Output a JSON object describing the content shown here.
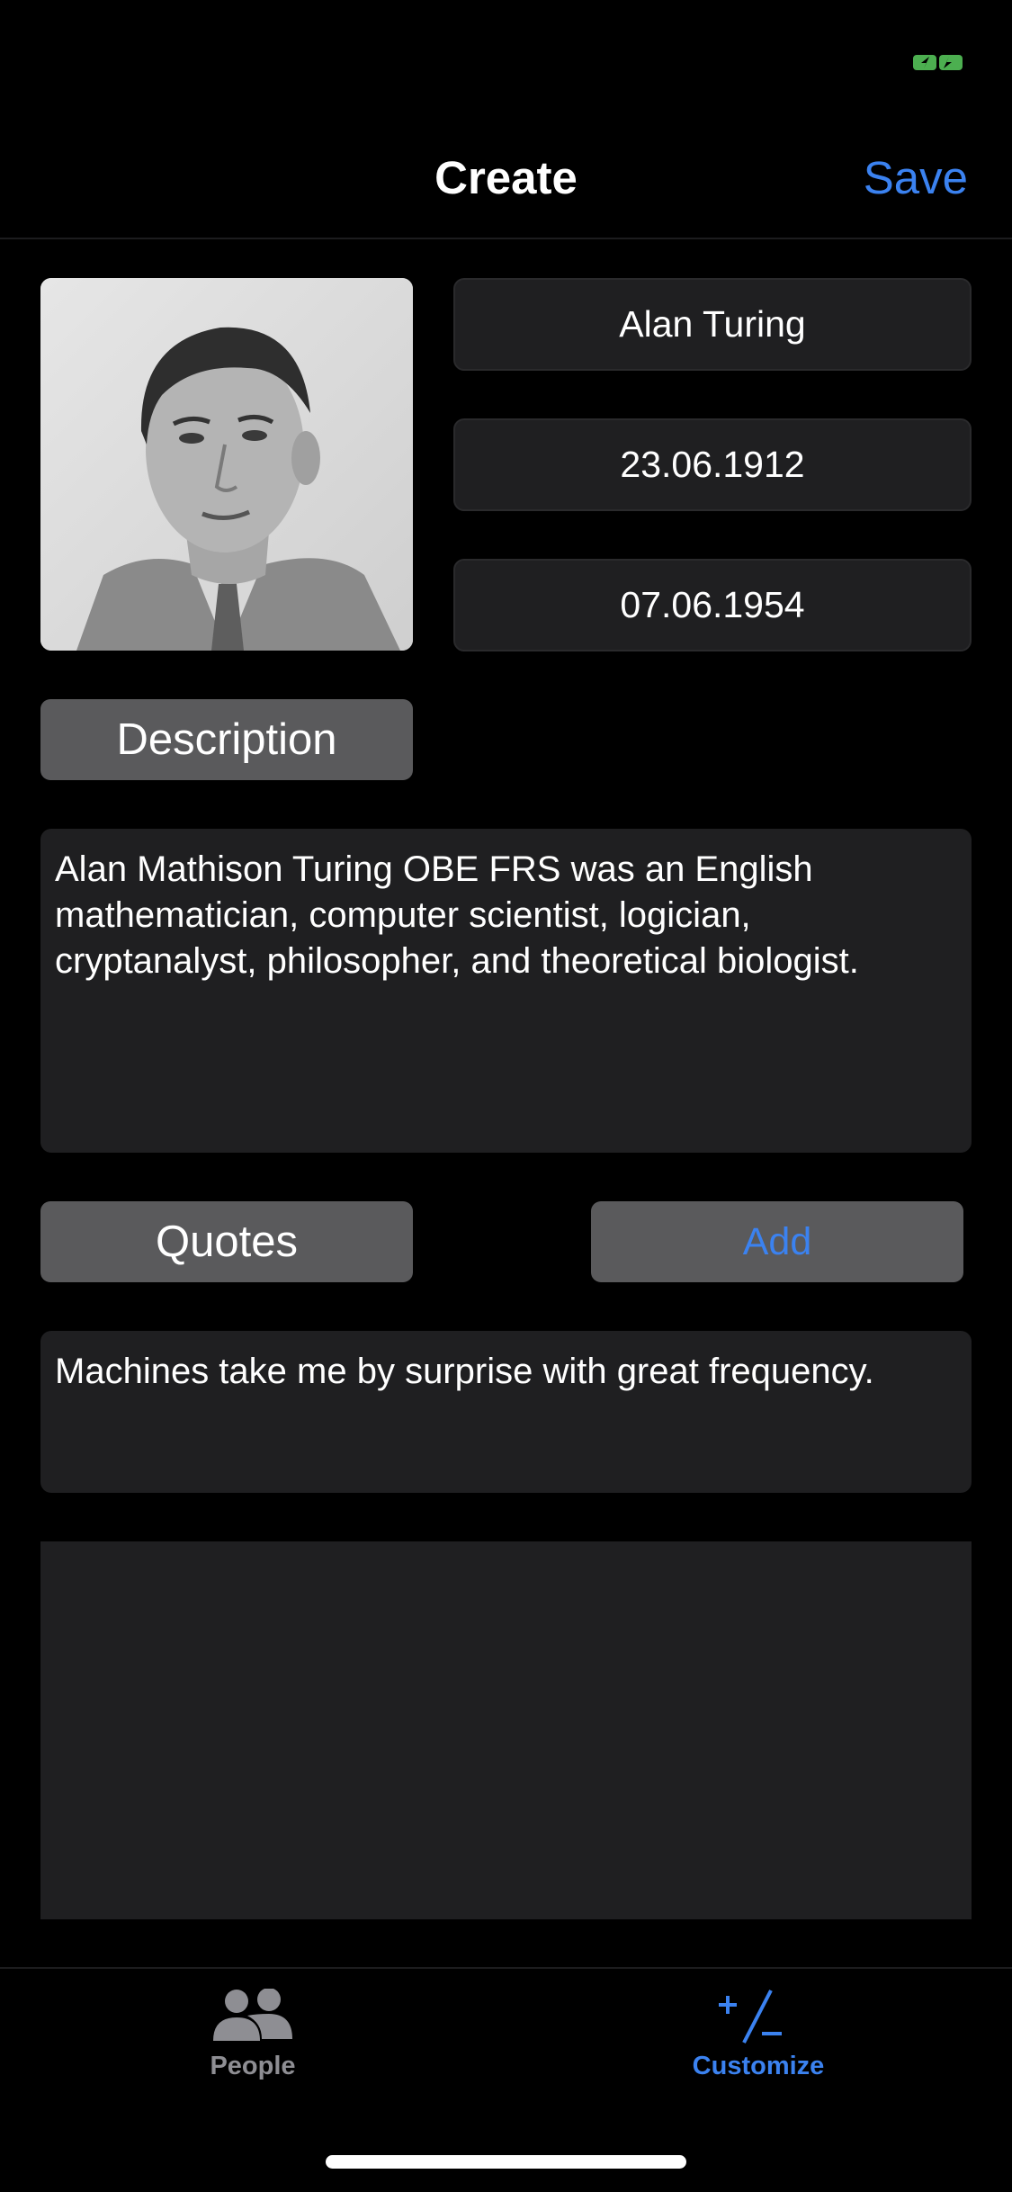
{
  "header": {
    "title": "Create",
    "save_label": "Save"
  },
  "person": {
    "name": "Alan Turing",
    "birth_date": "23.06.1912",
    "death_date": "07.06.1954"
  },
  "sections": {
    "description_label": "Description",
    "description_text": "Alan Mathison Turing OBE FRS was an English mathematician, computer scientist, logician, cryptanalyst, philosopher, and theoretical biologist.",
    "quotes_label": "Quotes",
    "add_label": "Add",
    "quote_text": "Machines take me by surprise with great frequency."
  },
  "tabbar": {
    "items": [
      {
        "label": "People",
        "icon": "people-icon",
        "selected": false
      },
      {
        "label": "Customize",
        "icon": "customize-icon",
        "selected": true
      }
    ]
  },
  "colors": {
    "accent": "#3b82f0",
    "background": "#000000",
    "field_background": "#1f1f21",
    "button_background": "#5a5a5c",
    "battery": "#4caf50"
  }
}
